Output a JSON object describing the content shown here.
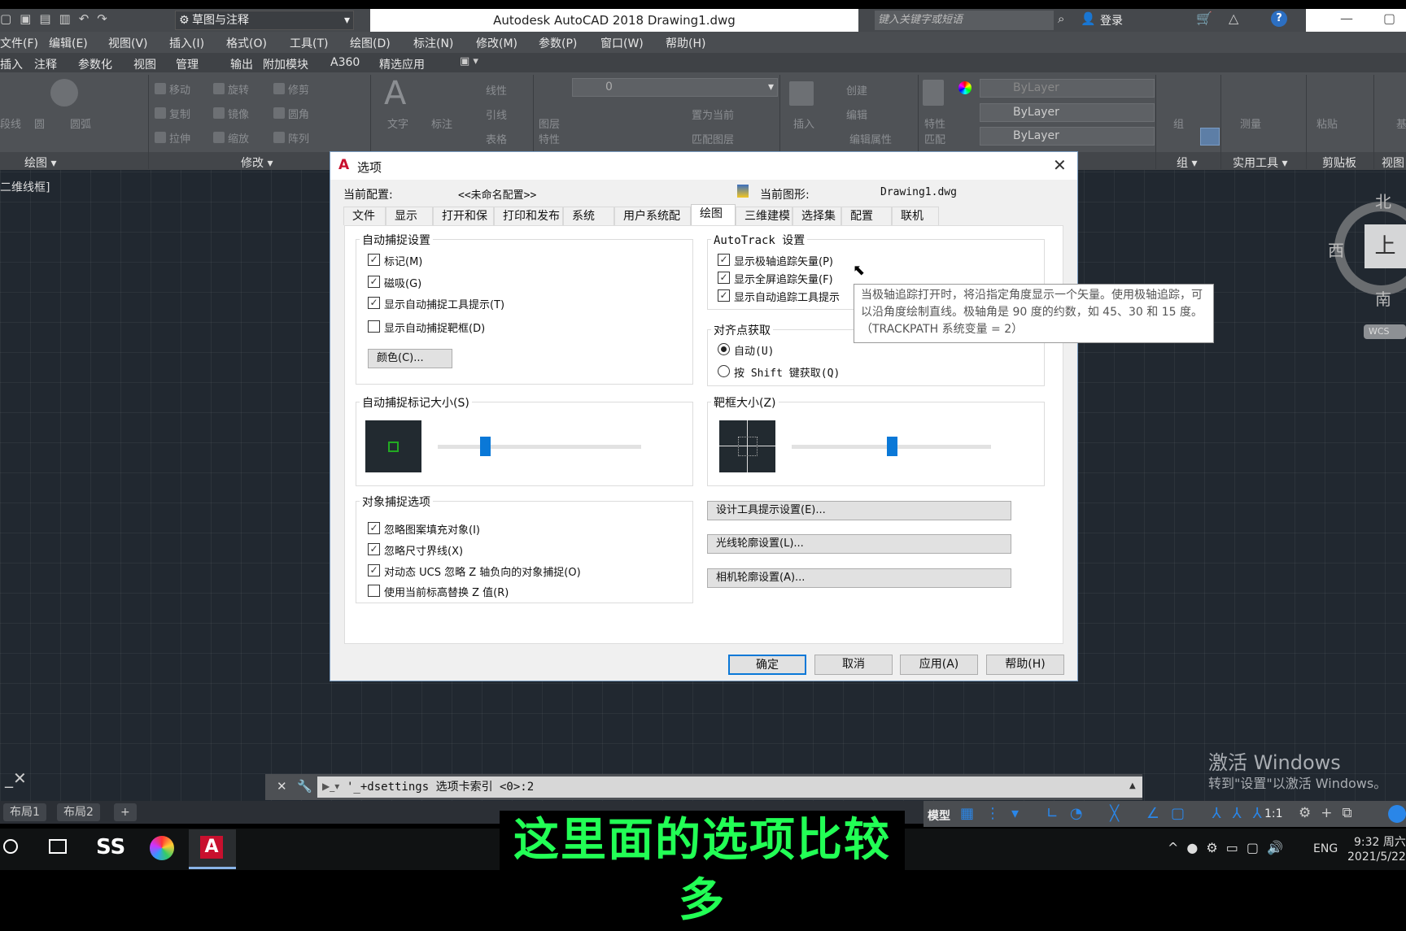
{
  "app": {
    "title": "Autodesk AutoCAD 2018    Drawing1.dwg",
    "workspace": "草图与注释",
    "search_placeholder": "键入关键字或短语",
    "login": "登录"
  },
  "menu": [
    "文件(F)",
    "编辑(E)",
    "视图(V)",
    "插入(I)",
    "格式(O)",
    "工具(T)",
    "绘图(D)",
    "标注(N)",
    "修改(M)",
    "参数(P)",
    "窗口(W)",
    "帮助(H)"
  ],
  "ribbon_tabs": [
    "插入",
    "注释",
    "参数化",
    "视图",
    "管理",
    "输出",
    "附加模块",
    "A360",
    "精选应用"
  ],
  "ribbon": {
    "draw": [
      "段线",
      "圆",
      "圆弧"
    ],
    "modify": [
      "移动",
      "旋转",
      "修剪",
      "复制",
      "镜像",
      "圆角",
      "拉伸",
      "缩放",
      "阵列"
    ],
    "annot": [
      "文字",
      "标注",
      "线性",
      "引线",
      "表格"
    ],
    "layers": {
      "label1": "图层",
      "label2": "特性",
      "layer": "0",
      "set_current": "置为当前",
      "match": "匹配图层"
    },
    "block": [
      "插入",
      "创建",
      "编辑",
      "编辑属性"
    ],
    "props": {
      "label1": "特性",
      "label2": "匹配",
      "color": "ByLayer",
      "linetype": "ByLayer",
      "lineweight": "ByLayer"
    },
    "group": "组",
    "measure": "测量",
    "paste": "粘贴",
    "base": "基",
    "panel_titles": [
      "绘图",
      "修改",
      "组",
      "实用工具",
      "剪贴板",
      "视图"
    ]
  },
  "viewport_label": "二维线框]",
  "viewcube": {
    "north": "北",
    "south": "南",
    "west": "西",
    "face": "上",
    "wcs": "WCS"
  },
  "dialog": {
    "title": "选项",
    "profile_label": "当前配置:",
    "profile_value": "<<未命名配置>>",
    "drawing_label": "当前图形:",
    "drawing_value": "Drawing1.dwg",
    "tabs": [
      "文件",
      "显示",
      "打开和保存",
      "打印和发布",
      "系统",
      "用户系统配置",
      "绘图",
      "三维建模",
      "选择集",
      "配置",
      "联机"
    ],
    "active_tab": "绘图",
    "autosnap": {
      "title": "自动捕捉设置",
      "items": [
        {
          "label": "标记(M)",
          "checked": true
        },
        {
          "label": "磁吸(G)",
          "checked": true
        },
        {
          "label": "显示自动捕捉工具提示(T)",
          "checked": true
        },
        {
          "label": "显示自动捕捉靶框(D)",
          "checked": false
        }
      ],
      "color_btn": "颜色(C)..."
    },
    "autotrack": {
      "title": "AutoTrack 设置",
      "items": [
        {
          "label": "显示极轴追踪矢量(P)",
          "checked": true
        },
        {
          "label": "显示全屏追踪矢量(F)",
          "checked": true
        },
        {
          "label": "显示自动追踪工具提示",
          "checked": true
        }
      ]
    },
    "alignment": {
      "title": "对齐点获取",
      "options": [
        {
          "label": "自动(U)",
          "selected": true
        },
        {
          "label": "按 Shift 键获取(Q)",
          "selected": false
        }
      ]
    },
    "marker_size": {
      "title": "自动捕捉标记大小(S)",
      "value_fraction": 0.23,
      "marker_color": "#22aa22"
    },
    "aperture_size": {
      "title": "靶框大小(Z)",
      "value_fraction": 0.5
    },
    "osnap": {
      "title": "对象捕捉选项",
      "items": [
        {
          "label": "忽略图案填充对象(I)",
          "checked": true
        },
        {
          "label": "忽略尺寸界线(X)",
          "checked": true
        },
        {
          "label": "对动态 UCS 忽略 Z 轴负向的对象捕捉(O)",
          "checked": true
        },
        {
          "label": "使用当前标高替换 Z 值(R)",
          "checked": false
        }
      ]
    },
    "side_buttons": [
      "设计工具提示设置(E)...",
      "光线轮廓设置(L)...",
      "相机轮廓设置(A)..."
    ],
    "buttons": [
      "确定",
      "取消",
      "应用(A)",
      "帮助(H)"
    ],
    "tooltip": "当极轴追踪打开时，将沿指定角度显示一个矢量。使用极轴追踪，可以沿角度绘制直线。极轴角是 90 度的约数，如 45、30 和 15 度。（TRACKPATH 系统变量 = 2）"
  },
  "command_line": "'_+dsettings 选项卡索引 <0>:2",
  "layout_tabs": [
    "布局1",
    "布局2",
    "+"
  ],
  "status": {
    "model": "模型",
    "scale": "1:1"
  },
  "watermark": {
    "line1": "激活 Windows",
    "line2": "转到\"设置\"以激活 Windows。"
  },
  "tray": {
    "lang": "ENG",
    "time": "9:32 周六",
    "date": "2021/5/22"
  },
  "subtitle": "这里面的选项比较多",
  "colors": {
    "canvas": "#212830",
    "accent": "#0a78d7",
    "subtitle": "#22ff55"
  }
}
